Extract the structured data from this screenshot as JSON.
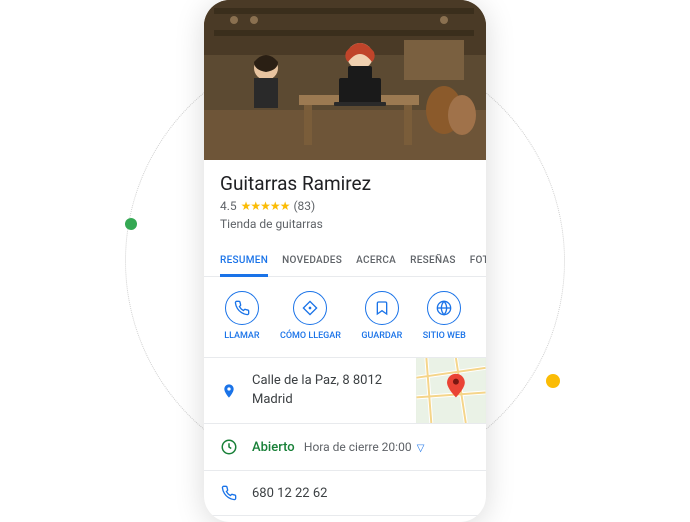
{
  "business": {
    "name": "Guitarras Ramirez",
    "rating": "4.5",
    "review_count": "(83)",
    "stars_display": "★★★★★",
    "category": "Tienda de guitarras"
  },
  "tabs": {
    "resumen": "RESUMEN",
    "novedades": "NOVEDADES",
    "acerca": "ACERCA",
    "resenas": "RESEÑAS",
    "fotos": "FOT"
  },
  "actions": {
    "call": "LLAMAR",
    "directions": "CÓMO LLEGAR",
    "save": "GUARDAR",
    "website": "SITIO WEB"
  },
  "address": {
    "line1": "Calle de la Paz, 8 8012",
    "line2": "Madrid"
  },
  "hours": {
    "status": "Abierto",
    "detail": "Hora de cierre 20:00"
  },
  "phone": "680 12 22 62"
}
